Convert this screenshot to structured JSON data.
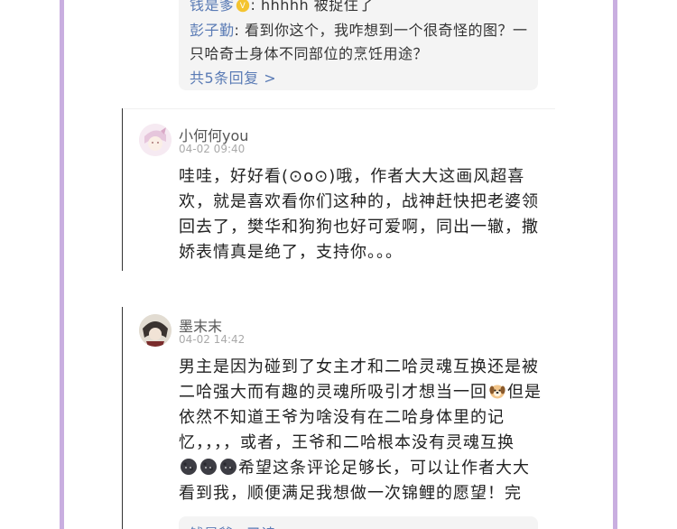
{
  "reply_thread": {
    "line1_name": "钱是爹",
    "line1_text": ": hhhhh 被捉住了",
    "line2_name": "彭子勤",
    "line2_text": ": 看到你这个，我咋想到一个很奇怪的图？一",
    "line3_text": "只哈奇士身体不同部位的烹饪用途？",
    "more_replies": "共5条回复 >"
  },
  "comments": [
    {
      "username": "小何何you",
      "timestamp": "04-02 09:40",
      "lines": [
        "哇哇，好好看(⊙o⊙)哦，作者大大这画风超喜",
        "欢，就是喜欢看你们这种的，战神赶快把老婆领",
        "回去了，樊华和狗狗也好可爱啊，同出一辙，撒",
        "娇表情真是绝了，支持你。。。"
      ]
    },
    {
      "username": "墨末末",
      "timestamp": "04-02 14:42",
      "line1": "男主是因为碰到了女主才和二哈灵魂互换还是被",
      "line2_a": "二哈强大而有趣的灵魂所吸引才想当一回",
      "line2_b": "但是",
      "line3": "依然不知道王爷为啥没有在二哈身体里的记",
      "line4": "忆，，，，或者，王爷和二哈根本没有灵魂互换",
      "line5_b": "希望这条评论足够长，可以让作者大大",
      "line6": "看到我，顺便满足我想做一次锦鲤的愿望！完"
    }
  ],
  "bottom_reply_partial": "钱是爹 · 已读"
}
